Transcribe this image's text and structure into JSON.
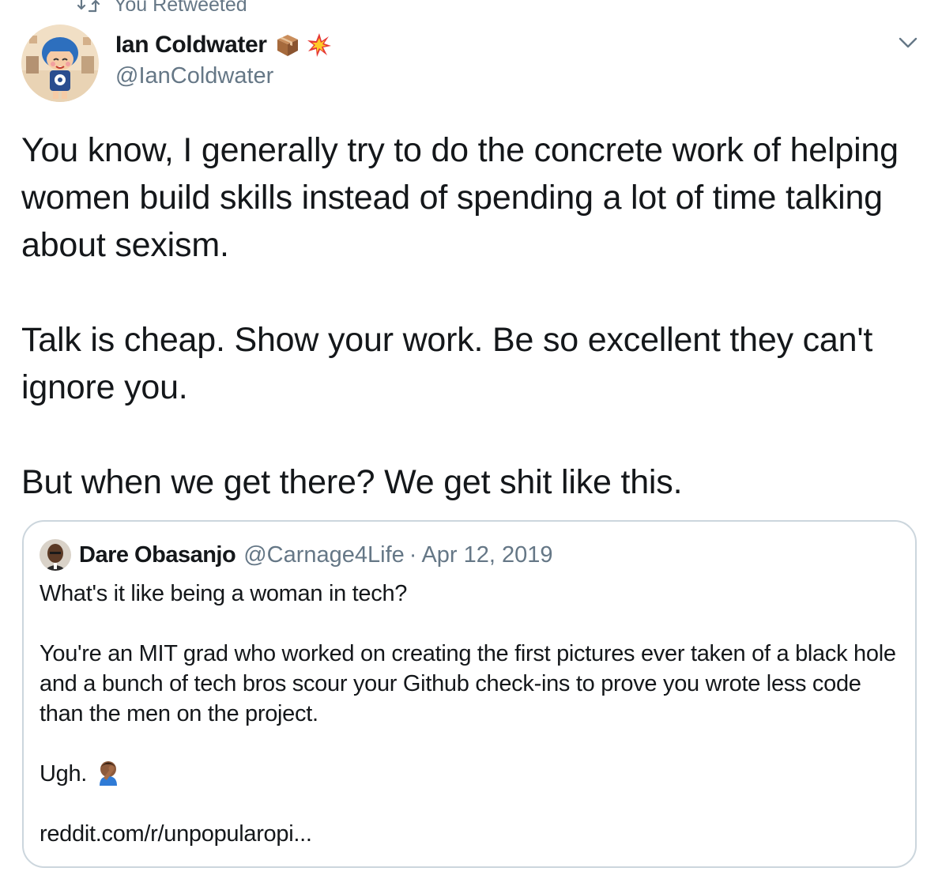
{
  "retweet": {
    "label": "You Retweeted",
    "icon": "retweet-icon"
  },
  "author": {
    "name": "Ian Coldwater",
    "handle": "@IanColdwater",
    "emoji": [
      "package-icon",
      "collision-icon"
    ],
    "avatar": "avatar-icon"
  },
  "menu": {
    "icon": "chevron-down-icon"
  },
  "tweet": {
    "paragraphs": [
      "You know, I generally try to do the concrete work of helping women build skills instead of spending a lot of time talking about sexism.",
      "Talk is cheap. Show your work. Be so excellent they can't ignore you.",
      "But when we get there? We get shit like this."
    ]
  },
  "quoted": {
    "name": "Dare Obasanjo",
    "handle": "@Carnage4Life",
    "separator": "·",
    "date": "Apr 12, 2019",
    "paragraphs": [
      "What's it like being a woman in tech?",
      "You're an MIT grad who worked on creating the first pictures ever taken of a black hole and a bunch of tech bros scour your Github check-ins to prove you wrote less code than the men on the project.",
      "Ugh.",
      "reddit.com/r/unpopularopi..."
    ],
    "emoji": "facepalm-icon"
  },
  "colors": {
    "text": "#14171a",
    "secondary": "#657786",
    "border": "#ccd6dd"
  }
}
